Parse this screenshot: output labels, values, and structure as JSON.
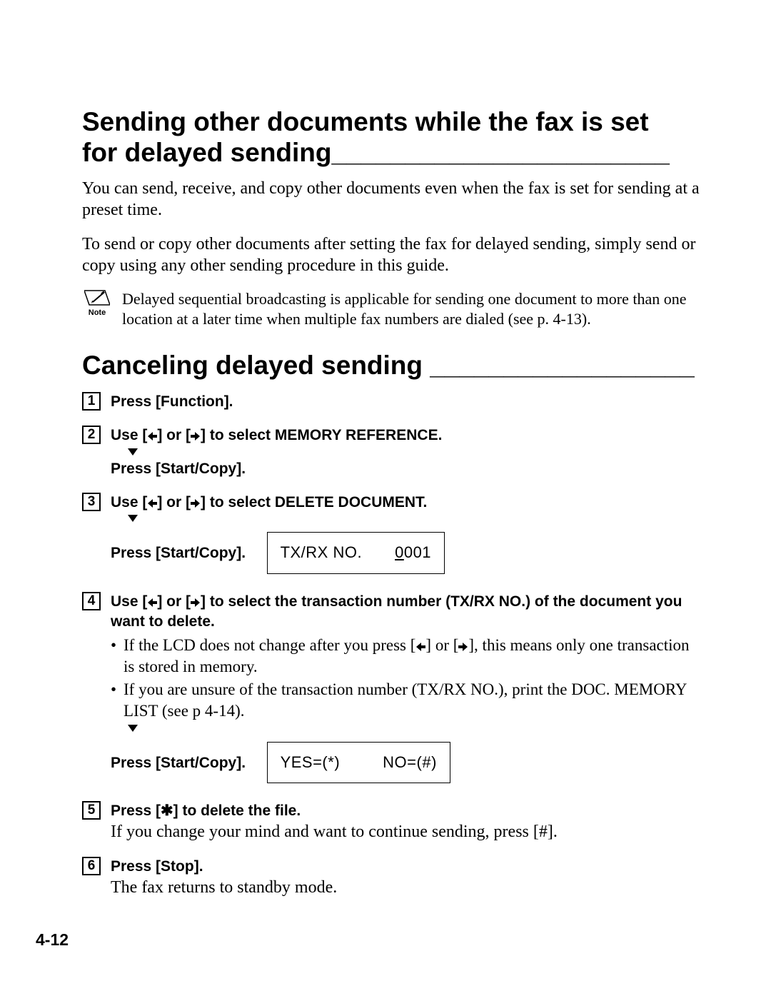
{
  "section1": {
    "title_line1": "Sending other documents while the fax is set",
    "title_line2_text": "for delayed sending",
    "title_line2_rule": "_______________________",
    "para1": "You can send, receive, and copy other documents even when the fax is set for sending at a preset time.",
    "para2": "To send or copy other documents after setting the fax for delayed sending, simply send or copy using any other sending procedure in this guide.",
    "note_label": "Note",
    "note_text": "Delayed sequential broadcasting is applicable for sending one document to more than one location at a later time when multiple fax numbers are dialed (see p. 4-13)."
  },
  "section2": {
    "title_text": "Canceling delayed sending ",
    "title_rule": "__________________",
    "steps": {
      "s1": {
        "num": "1",
        "bold": "Press [Function]."
      },
      "s2": {
        "num": "2",
        "bold_parts": {
          "a": "Use [",
          "b": "] or [",
          "c": "] to select MEMORY REFERENCE."
        },
        "press": "Press [Start/Copy]."
      },
      "s3": {
        "num": "3",
        "bold_parts": {
          "a": "Use [",
          "b": "] or [",
          "c": "] to select DELETE DOCUMENT."
        },
        "press": "Press [Start/Copy].",
        "lcd": {
          "label": "TX/RX NO.",
          "value_u": "0",
          "value_rest": "001"
        }
      },
      "s4": {
        "num": "4",
        "bold_parts": {
          "a": "Use [",
          "b": "] or [",
          "c": "] to select the transaction number (TX/RX NO.) of the document you want to delete."
        },
        "bullet1_a": "If the LCD does not change after you press [",
        "bullet1_b": "] or [",
        "bullet1_c": "], this means only one transaction is stored in memory.",
        "bullet2": "If you are unsure of the transaction number (TX/RX NO.), print the DOC. MEMORY LIST (see p 4-14).",
        "press": "Press [Start/Copy].",
        "lcd": {
          "yes": "YES=(*)",
          "no": "NO=(#)"
        }
      },
      "s5": {
        "num": "5",
        "bold_parts": {
          "a": "Press [",
          "b": "] to delete the file."
        },
        "star": "✱",
        "plain": "If you change your mind and want to continue sending, press [#]."
      },
      "s6": {
        "num": "6",
        "bold": "Press [Stop].",
        "plain": "The fax returns to standby mode."
      }
    }
  },
  "page_number": "4-12"
}
